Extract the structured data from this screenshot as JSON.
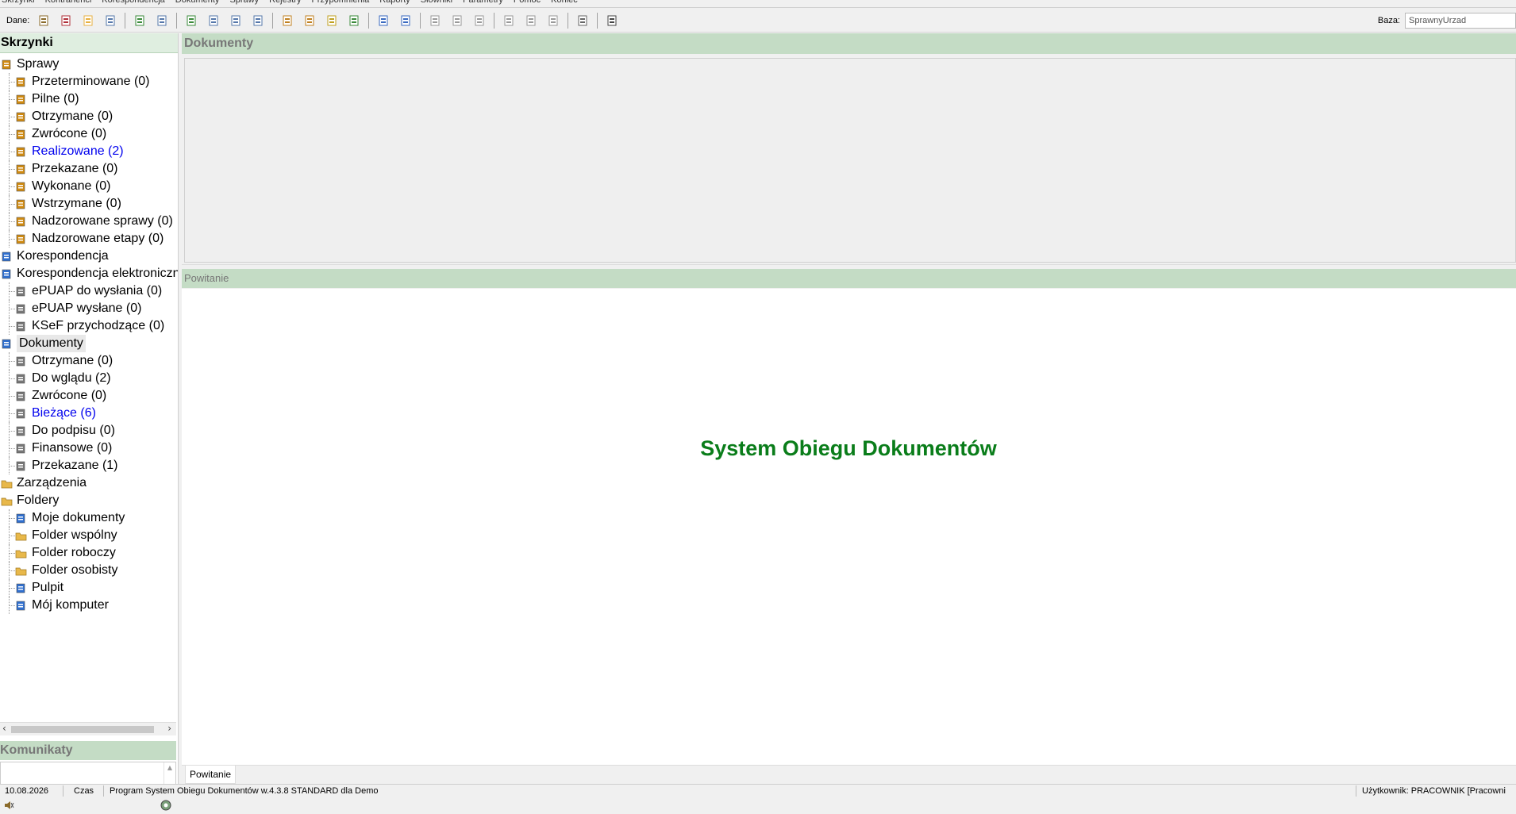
{
  "menu": [
    "Skrzynki",
    "Kontrahenci",
    "Korespondencja",
    "Dokumenty",
    "Sprawy",
    "Rejestry",
    "Przypomnienia",
    "Raporty",
    "Słowniki",
    "Parametry",
    "Pomoc",
    "Koniec"
  ],
  "toolbar": {
    "dane_label": "Dane:",
    "baza_label": "Baza:",
    "baza_value": "SprawnyUrzad"
  },
  "left_panel": {
    "header": "Skrzynki",
    "tree": [
      {
        "label": "Sprawy",
        "level": 0,
        "icon": "case-briefcase-icon"
      },
      {
        "label": "Przeterminowane (0)",
        "level": 1,
        "icon": "overdue-case-icon"
      },
      {
        "label": "Pilne (0)",
        "level": 1,
        "icon": "urgent-case-icon"
      },
      {
        "label": "Otrzymane (0)",
        "level": 1,
        "icon": "received-case-icon"
      },
      {
        "label": "Zwrócone (0)",
        "level": 1,
        "icon": "returned-case-icon"
      },
      {
        "label": "Realizowane (2)",
        "level": 1,
        "icon": "in-progress-case-icon",
        "highlight": true
      },
      {
        "label": "Przekazane (0)",
        "level": 1,
        "icon": "forwarded-case-icon"
      },
      {
        "label": "Wykonane (0)",
        "level": 1,
        "icon": "done-case-icon"
      },
      {
        "label": "Wstrzymane (0)",
        "level": 1,
        "icon": "paused-case-icon"
      },
      {
        "label": "Nadzorowane sprawy (0)",
        "level": 1,
        "icon": "supervised-cases-icon"
      },
      {
        "label": "Nadzorowane etapy (0)",
        "level": 1,
        "icon": "supervised-stages-icon"
      },
      {
        "label": "Korespondencja",
        "level": 0,
        "icon": "correspondence-icon"
      },
      {
        "label": "Korespondencja elektronicznа",
        "level": 0,
        "icon": "e-correspondence-icon"
      },
      {
        "label": "ePUAP do wysłania (0)",
        "level": 1,
        "icon": "epuap-outbox-icon"
      },
      {
        "label": "ePUAP wysłane (0)",
        "level": 1,
        "icon": "epuap-sent-icon"
      },
      {
        "label": "KSeF przychodzące (0)",
        "level": 1,
        "icon": "ksef-icon"
      },
      {
        "label": "Dokumenty",
        "level": 0,
        "icon": "documents-icon",
        "selected": true
      },
      {
        "label": "Otrzymane (0)",
        "level": 1,
        "icon": "doc-received-icon"
      },
      {
        "label": "Do wglądu (2)",
        "level": 1,
        "icon": "doc-review-icon"
      },
      {
        "label": "Zwrócone (0)",
        "level": 1,
        "icon": "doc-returned-icon"
      },
      {
        "label": "Bieżące (6)",
        "level": 1,
        "icon": "doc-current-icon",
        "highlight": true
      },
      {
        "label": "Do podpisu (0)",
        "level": 1,
        "icon": "doc-sign-icon"
      },
      {
        "label": "Finansowe (0)",
        "level": 1,
        "icon": "doc-finance-icon"
      },
      {
        "label": "Przekazane (1)",
        "level": 1,
        "icon": "doc-forwarded-icon"
      },
      {
        "label": "Zarządzenia",
        "level": 0,
        "icon": "folder-icon"
      },
      {
        "label": "Foldery",
        "level": 0,
        "icon": "folder-open-icon"
      },
      {
        "label": "Moje dokumenty",
        "level": 1,
        "icon": "my-documents-icon"
      },
      {
        "label": "Folder wspólny",
        "level": 1,
        "icon": "shared-folder-icon"
      },
      {
        "label": "Folder roboczy",
        "level": 1,
        "icon": "work-folder-icon"
      },
      {
        "label": "Folder osobisty",
        "level": 1,
        "icon": "personal-folder-icon"
      },
      {
        "label": "Pulpit",
        "level": 1,
        "icon": "desktop-icon"
      },
      {
        "label": "Mój komputer",
        "level": 1,
        "icon": "computer-icon"
      }
    ],
    "messages_header": "Komunikaty"
  },
  "documents_panel": {
    "header": "Dokumenty"
  },
  "welcome_panel": {
    "header": "Powitanie",
    "title": "System Obiegu Dokumentów",
    "tab_label": "Powitanie"
  },
  "status": {
    "date": "10.08.2026",
    "time_label": "Czas",
    "program": "Program System Obiegu Dokumentów w.4.3.8 STANDARD dla Demo",
    "user": "Użytkownik: PRACOWNIK [Pracowni"
  },
  "colors": {
    "panel_header": "#c4dcc5",
    "welcome_title": "#0a7d1a",
    "highlight_link": "#0000ee"
  }
}
